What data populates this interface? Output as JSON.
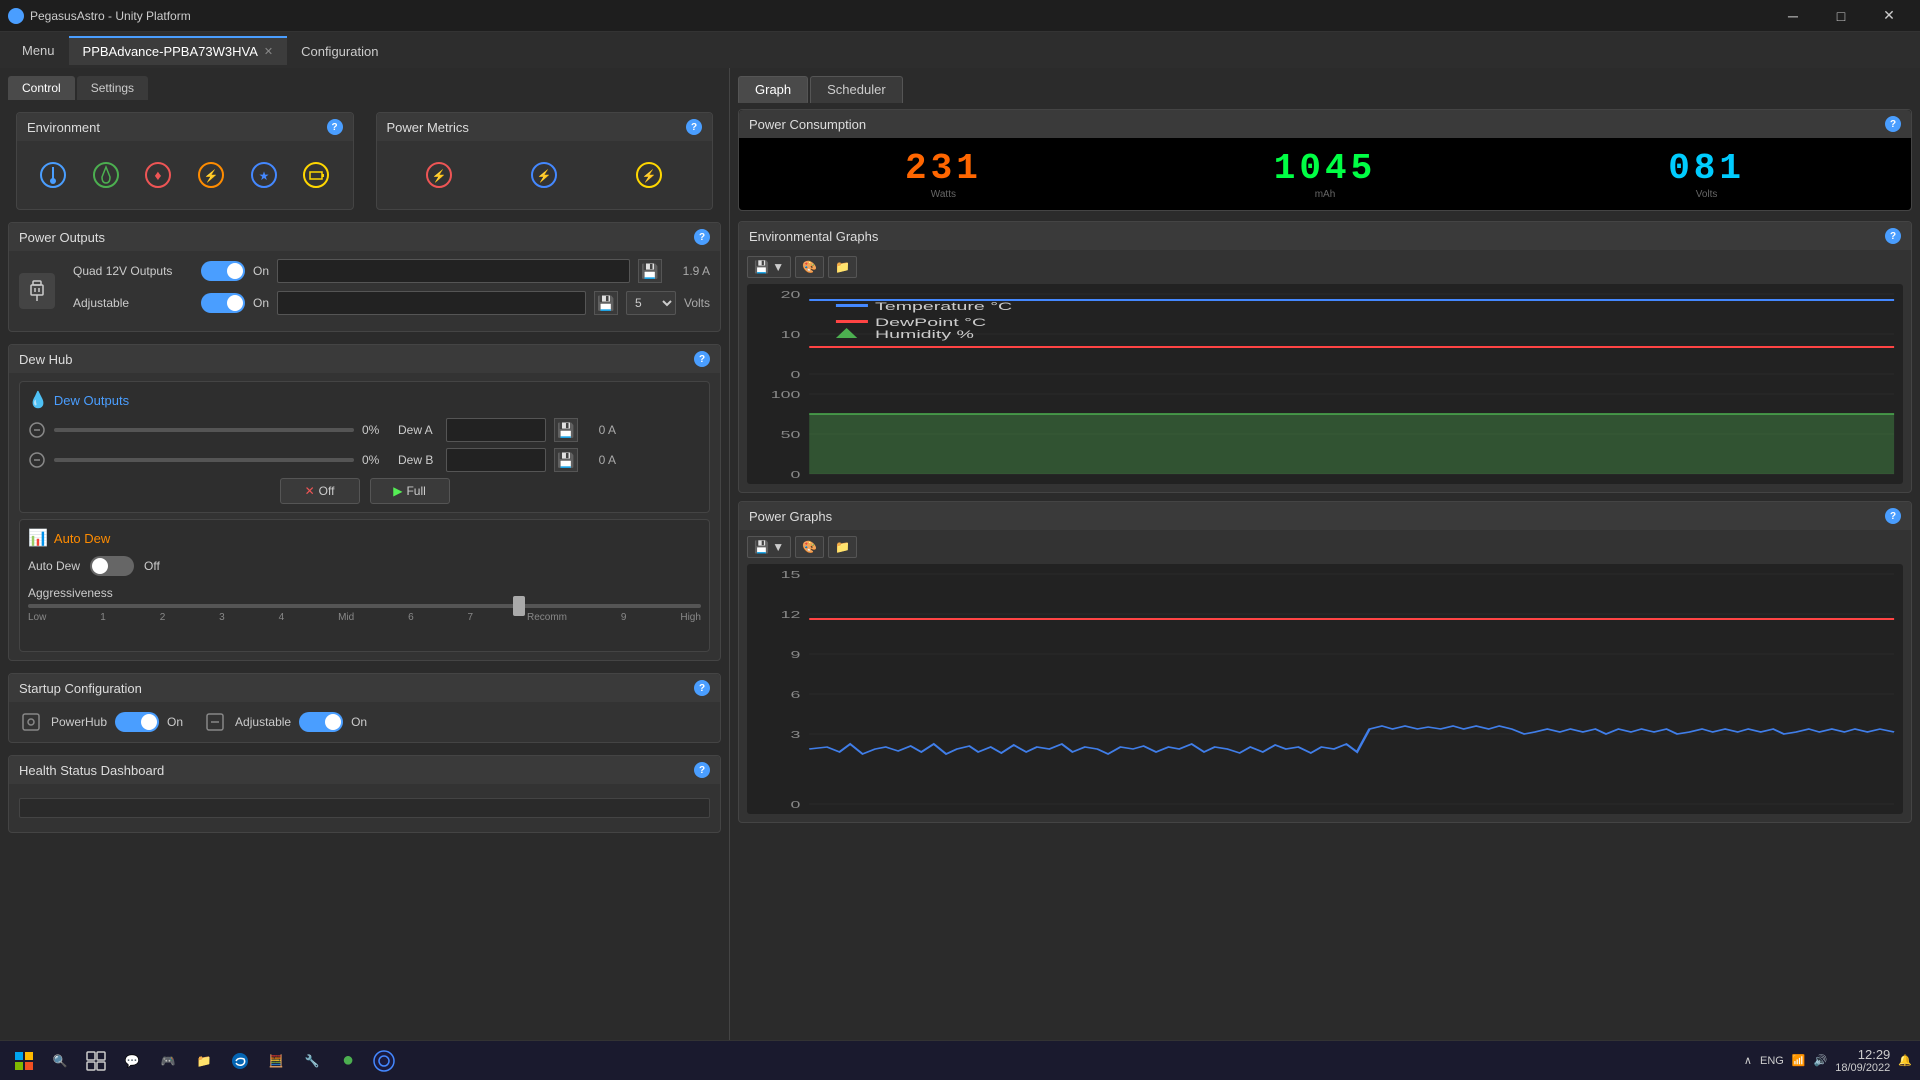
{
  "app": {
    "title": "PegasusAstro - Unity Platform",
    "icon": "●"
  },
  "titlebar": {
    "minimize": "─",
    "maximize": "□",
    "close": "✕"
  },
  "menubar": {
    "menu_label": "Menu",
    "tabs": [
      {
        "label": "PPBAdvance-PPBA73W3HVA",
        "active": true,
        "closable": true
      },
      {
        "label": "Configuration",
        "active": false,
        "closable": false
      }
    ]
  },
  "left_panel": {
    "sub_tabs": [
      "Control",
      "Settings"
    ],
    "active_sub_tab": "Control",
    "sections": {
      "environment": {
        "title": "Environment",
        "icons": [
          "🌡",
          "💧",
          "🔴",
          "⚡",
          "🔵",
          "🔋"
        ]
      },
      "power_metrics": {
        "title": "Power Metrics",
        "icons": [
          "🔴",
          "🔵",
          "🟡"
        ]
      },
      "power_outputs": {
        "title": "Power Outputs",
        "quad_label": "Quad 12V Outputs",
        "quad_toggle": "on",
        "quad_on_label": "On",
        "quad_ampere": "1.9 A",
        "adjustable_label": "Adjustable",
        "adjustable_toggle": "on",
        "adjustable_on_label": "On",
        "adjustable_volts_label": "Volts",
        "adjustable_volt_value": "5"
      },
      "dew_hub": {
        "title": "Dew Hub",
        "dew_outputs_title": "Dew Outputs",
        "dew_a_label": "Dew A",
        "dew_b_label": "Dew B",
        "dew_a_pct": "0%",
        "dew_b_pct": "0%",
        "dew_a_amp": "0 A",
        "dew_b_amp": "0 A",
        "off_btn": "Off",
        "full_btn": "Full",
        "auto_dew_title": "Auto Dew",
        "auto_dew_label": "Auto Dew",
        "auto_dew_state": "Off",
        "aggressiveness_label": "Aggressiveness",
        "aggressiveness_marks": [
          "Low",
          "1",
          "2",
          "3",
          "4",
          "Mid",
          "6",
          "7",
          "Recomm",
          "9",
          "High"
        ]
      },
      "startup_config": {
        "title": "Startup Configuration",
        "powerhub_label": "PowerHub",
        "powerhub_toggle": "on",
        "powerhub_on_label": "On",
        "adjustable_label": "Adjustable",
        "adjustable_toggle": "on",
        "adjustable_on_label": "On"
      },
      "health_status": {
        "title": "Health Status Dashboard"
      }
    }
  },
  "right_panel": {
    "tabs": [
      "Graph",
      "Scheduler"
    ],
    "active_tab": "Graph",
    "power_consumption": {
      "title": "Power Consumption",
      "value1": "231",
      "value1_color": "orange",
      "value2": "1045",
      "value2_color": "green",
      "value3": "081",
      "value3_color": "cyan"
    },
    "env_graphs": {
      "title": "Environmental Graphs",
      "legend": [
        {
          "label": "Temperature °C",
          "color": "#4488ff",
          "type": "line"
        },
        {
          "label": "DewPoint °C",
          "color": "#ff4444",
          "type": "line"
        },
        {
          "label": "Humidity %",
          "color": "#4caf50",
          "type": "triangle"
        }
      ],
      "y_axis_top": [
        "20",
        "10",
        "0"
      ],
      "y_axis_bottom": [
        "100",
        "50",
        "0"
      ],
      "toolbar": [
        "💾",
        "🎨",
        "📁"
      ]
    },
    "power_graphs": {
      "title": "Power Graphs",
      "y_axis": [
        "15",
        "12",
        "9",
        "6",
        "3",
        "0"
      ],
      "toolbar": [
        "💾",
        "🎨",
        "📁"
      ]
    }
  },
  "taskbar": {
    "time": "12:29",
    "date": "18/09/2022",
    "start_icon": "⊞",
    "lang": "ENG",
    "icons": [
      "🔍",
      "📁",
      "💬",
      "🎮",
      "📂",
      "🌐",
      "🧮",
      "🔧",
      "🟢",
      "🔵",
      "🌐"
    ]
  }
}
